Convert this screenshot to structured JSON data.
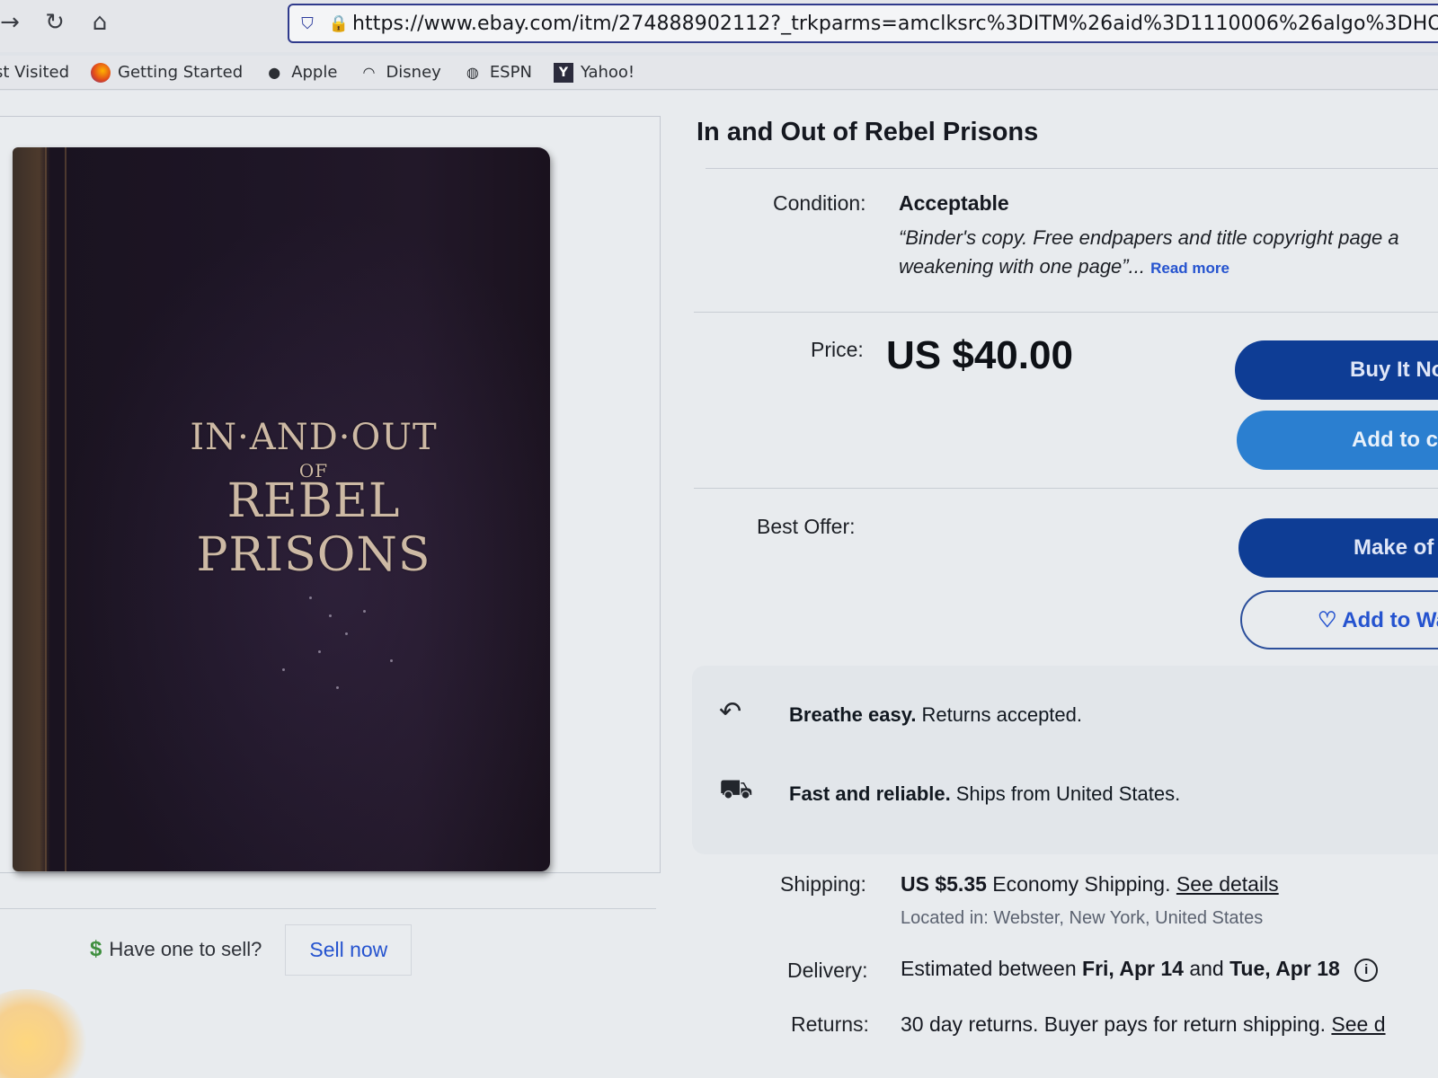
{
  "browser": {
    "url": "https://www.ebay.com/itm/274888902112?_trkparms=amclksrc%3DITM%26aid%3D1110006%26algo%3DHO",
    "bookmarks": [
      {
        "label": "st Visited",
        "icon": "none"
      },
      {
        "label": "Getting Started",
        "icon": "firefox-icon"
      },
      {
        "label": "Apple",
        "icon": "apple-icon"
      },
      {
        "label": "Disney",
        "icon": "disney-icon"
      },
      {
        "label": "ESPN",
        "icon": "globe-icon"
      },
      {
        "label": "Yahoo!",
        "icon": "yahoo-icon"
      }
    ]
  },
  "product": {
    "title": "In and Out of Rebel Prisons",
    "cover_text": {
      "line1": "IN·AND·OUT",
      "of": "OF",
      "line2": "REBEL PRISONS"
    },
    "condition_label": "Condition:",
    "condition_value": "Acceptable",
    "condition_note_line1": "“Binder's copy. Free endpapers and title copyright page a",
    "condition_note_line2": "weakening with one page”...",
    "read_more": "Read more",
    "price_label": "Price:",
    "price": "US $40.00",
    "best_offer_label": "Best Offer:"
  },
  "actions": {
    "buy_now": "Buy It No",
    "add_to_cart": "Add to c",
    "make_offer": "Make of",
    "add_to_watchlist": "♡ Add to Wa"
  },
  "perks": {
    "returns_bold": "Breathe easy.",
    "returns_text": "Returns accepted.",
    "shipping_bold": "Fast and reliable.",
    "shipping_text": "Ships from United States."
  },
  "details": {
    "shipping_label": "Shipping:",
    "shipping_cost": "US $5.35",
    "shipping_method": "Economy Shipping.",
    "see_details": "See details",
    "location": "Located in: Webster, New York, United States",
    "delivery_label": "Delivery:",
    "delivery_pre": "Estimated between",
    "delivery_start": "Fri, Apr 14",
    "delivery_and": "and",
    "delivery_end": "Tue, Apr 18",
    "returns_label": "Returns:",
    "returns_text": "30 day returns. Buyer pays for return shipping.",
    "returns_link": "See d"
  },
  "sell": {
    "question": "Have one to sell?",
    "button": "Sell now"
  }
}
